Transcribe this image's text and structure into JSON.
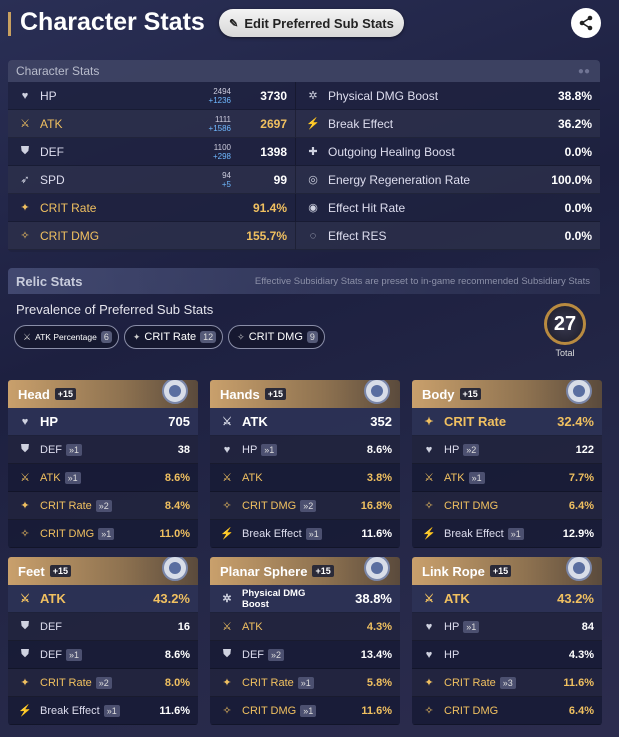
{
  "header": {
    "title": "Character Stats",
    "edit_label": "Edit Preferred Sub Stats",
    "edit_icon": "pencil-icon",
    "share_icon": "share-icon"
  },
  "stats_panel": {
    "title": "Character Stats",
    "left": [
      {
        "name": "HP",
        "icon": "hp-icon",
        "base": "2494",
        "add": "+1236",
        "value": "3730",
        "gold": false
      },
      {
        "name": "ATK",
        "icon": "atk-icon",
        "base": "1111",
        "add": "+1586",
        "value": "2697",
        "gold": true
      },
      {
        "name": "DEF",
        "icon": "def-icon",
        "base": "1100",
        "add": "+298",
        "value": "1398",
        "gold": false
      },
      {
        "name": "SPD",
        "icon": "spd-icon",
        "base": "94",
        "add": "+5",
        "value": "99",
        "gold": false
      },
      {
        "name": "CRIT Rate",
        "icon": "crit-rate-icon",
        "base": "",
        "add": "",
        "value": "91.4%",
        "gold": true
      },
      {
        "name": "CRIT DMG",
        "icon": "crit-dmg-icon",
        "base": "",
        "add": "",
        "value": "155.7%",
        "gold": true
      }
    ],
    "right": [
      {
        "name": "Physical DMG Boost",
        "icon": "physical-icon",
        "value": "38.8%"
      },
      {
        "name": "Break Effect",
        "icon": "break-icon",
        "value": "36.2%"
      },
      {
        "name": "Outgoing Healing Boost",
        "icon": "heal-icon",
        "value": "0.0%"
      },
      {
        "name": "Energy Regeneration Rate",
        "icon": "energy-icon",
        "value": "100.0%"
      },
      {
        "name": "Effect Hit Rate",
        "icon": "effect-hit-icon",
        "value": "0.0%"
      },
      {
        "name": "Effect RES",
        "icon": "effect-res-icon",
        "value": "0.0%"
      }
    ]
  },
  "relic": {
    "title": "Relic Stats",
    "note": "Effective Subsidiary Stats are preset to in-game recommended Subsidiary Stats",
    "prevalence_title": "Prevalence of Preferred Sub Stats",
    "chips": [
      {
        "label": "ATK Percentage",
        "count": "6"
      },
      {
        "label": "CRIT Rate",
        "count": "12"
      },
      {
        "label": "CRIT DMG",
        "count": "9"
      }
    ],
    "total_value": "27",
    "total_label": "Total",
    "cards": [
      {
        "name": "Head",
        "level": "+15",
        "main": {
          "name": "HP",
          "value": "705",
          "gold": false
        },
        "subs": [
          {
            "name": "DEF",
            "roll": "1",
            "value": "38",
            "gold": false
          },
          {
            "name": "ATK",
            "roll": "1",
            "value": "8.6%",
            "gold": true
          },
          {
            "name": "CRIT Rate",
            "roll": "2",
            "value": "8.4%",
            "gold": true
          },
          {
            "name": "CRIT DMG",
            "roll": "1",
            "value": "11.0%",
            "gold": true
          }
        ]
      },
      {
        "name": "Hands",
        "level": "+15",
        "main": {
          "name": "ATK",
          "value": "352",
          "gold": false
        },
        "subs": [
          {
            "name": "HP",
            "roll": "1",
            "value": "8.6%",
            "gold": false
          },
          {
            "name": "ATK",
            "roll": "",
            "value": "3.8%",
            "gold": true
          },
          {
            "name": "CRIT DMG",
            "roll": "2",
            "value": "16.8%",
            "gold": true
          },
          {
            "name": "Break Effect",
            "roll": "1",
            "value": "11.6%",
            "gold": false
          }
        ]
      },
      {
        "name": "Body",
        "level": "+15",
        "main": {
          "name": "CRIT Rate",
          "value": "32.4%",
          "gold": true
        },
        "subs": [
          {
            "name": "HP",
            "roll": "2",
            "value": "122",
            "gold": false
          },
          {
            "name": "ATK",
            "roll": "1",
            "value": "7.7%",
            "gold": true
          },
          {
            "name": "CRIT DMG",
            "roll": "",
            "value": "6.4%",
            "gold": true
          },
          {
            "name": "Break Effect",
            "roll": "1",
            "value": "12.9%",
            "gold": false
          }
        ]
      },
      {
        "name": "Feet",
        "level": "+15",
        "main": {
          "name": "ATK",
          "value": "43.2%",
          "gold": true
        },
        "subs": [
          {
            "name": "DEF",
            "roll": "",
            "value": "16",
            "gold": false
          },
          {
            "name": "DEF",
            "roll": "1",
            "value": "8.6%",
            "gold": false
          },
          {
            "name": "CRIT Rate",
            "roll": "2",
            "value": "8.0%",
            "gold": true
          },
          {
            "name": "Break Effect",
            "roll": "1",
            "value": "11.6%",
            "gold": false
          }
        ]
      },
      {
        "name": "Planar Sphere",
        "level": "+15",
        "main": {
          "name": "Physical DMG Boost",
          "value": "38.8%",
          "gold": false,
          "small": true
        },
        "subs": [
          {
            "name": "ATK",
            "roll": "",
            "value": "4.3%",
            "gold": true
          },
          {
            "name": "DEF",
            "roll": "2",
            "value": "13.4%",
            "gold": false
          },
          {
            "name": "CRIT Rate",
            "roll": "1",
            "value": "5.8%",
            "gold": true
          },
          {
            "name": "CRIT DMG",
            "roll": "1",
            "value": "11.6%",
            "gold": true
          }
        ]
      },
      {
        "name": "Link Rope",
        "level": "+15",
        "main": {
          "name": "ATK",
          "value": "43.2%",
          "gold": true
        },
        "subs": [
          {
            "name": "HP",
            "roll": "1",
            "value": "84",
            "gold": false
          },
          {
            "name": "HP",
            "roll": "",
            "value": "4.3%",
            "gold": false
          },
          {
            "name": "CRIT Rate",
            "roll": "3",
            "value": "11.6%",
            "gold": true
          },
          {
            "name": "CRIT DMG",
            "roll": "",
            "value": "6.4%",
            "gold": true
          }
        ]
      }
    ]
  },
  "colors": {
    "gold": "#f0c060",
    "accent_blue": "#6fb8ff"
  }
}
